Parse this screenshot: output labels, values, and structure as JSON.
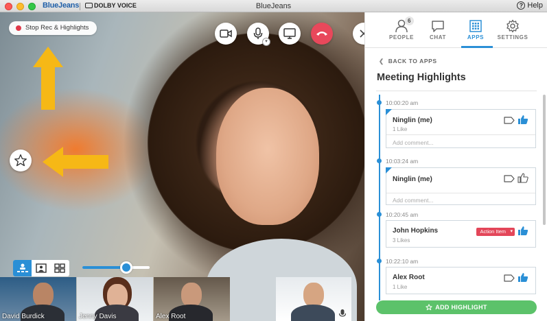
{
  "titlebar": {
    "brand": "BlueJeans",
    "partner": "DOLBY VOICE",
    "title": "BlueJeans",
    "help": "Help"
  },
  "video": {
    "stop_rec_label": "Stop Rec & Highlights",
    "participants": [
      {
        "name": "David Burdick"
      },
      {
        "name": "Jenny Davis"
      },
      {
        "name": "Alex Root"
      }
    ]
  },
  "panel": {
    "tabs": [
      {
        "label": "PEOPLE",
        "badge": "6"
      },
      {
        "label": "CHAT"
      },
      {
        "label": "APPS",
        "active": true
      },
      {
        "label": "SETTINGS"
      }
    ],
    "back_label": "BACK TO APPS",
    "title": "Meeting Highlights",
    "highlights": [
      {
        "time": "10:00:20 am",
        "name": "Ninglin (me)",
        "likes": "1 Like",
        "comment_placeholder": "Add comment..."
      },
      {
        "time": "10:03:24 am",
        "name": "Ninglin (me)",
        "likes": "",
        "comment_placeholder": "Add comment..."
      },
      {
        "time": "10:20:45 am",
        "name": "John Hopkins",
        "likes": "3 Likes",
        "tag": "Action Item",
        "comment_placeholder": ""
      },
      {
        "time": "10:22:10 am",
        "name": "Alex Root",
        "likes": "1 Like",
        "comment_placeholder": ""
      }
    ],
    "add_highlight_label": "ADD HIGHLIGHT"
  },
  "colors": {
    "accent": "#2a8fd6",
    "hangup": "#e8485b",
    "action_tag": "#e34659",
    "add_button": "#5cc26a",
    "arrow": "#f6b816"
  },
  "icons": [
    "camera-icon",
    "microphone-icon",
    "screen-share-icon",
    "hangup-icon",
    "close-icon",
    "star-icon",
    "people-icon",
    "chat-icon",
    "apps-icon",
    "settings-icon",
    "tag-icon",
    "thumbs-up-icon"
  ]
}
